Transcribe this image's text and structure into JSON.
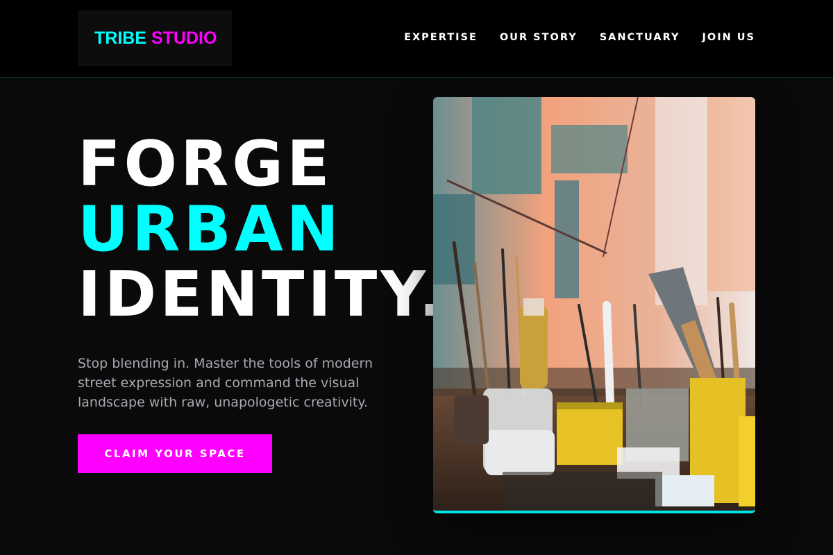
{
  "brand": {
    "part1": "TRIBE",
    "part2": "STUDIO",
    "color1": "#00ffff",
    "color2": "#ff00ff"
  },
  "nav": {
    "items": [
      {
        "label": "EXPERTISE"
      },
      {
        "label": "OUR STORY"
      },
      {
        "label": "SANCTUARY"
      },
      {
        "label": "JOIN US"
      }
    ]
  },
  "hero": {
    "line1": "FORGE",
    "line2": "URBAN",
    "line3": "IDENTITY.",
    "subtitle": "Stop blending in. Master the tools of modern street expression and command the visual landscape with raw, unapologetic creativity.",
    "cta": "CLAIM YOUR SPACE",
    "accent": "#00ffff",
    "cta_color": "#ff00ff"
  },
  "image": {
    "icon": "art-studio-brushes-photo"
  }
}
